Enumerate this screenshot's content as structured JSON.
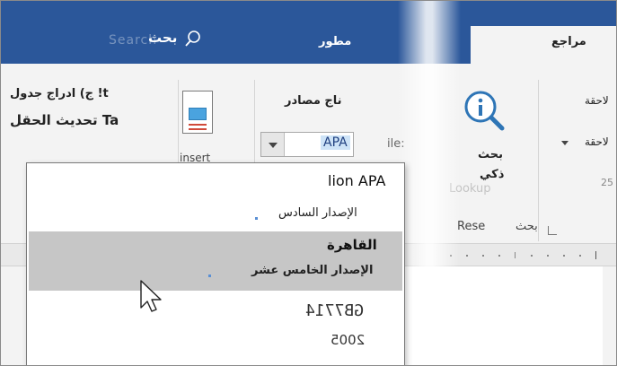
{
  "tabs": {
    "references": "مراجع",
    "developer": "مطور"
  },
  "search": {
    "label": "بحث",
    "ghost_text": "Search"
  },
  "ribbon": {
    "insert_table_line": "ج) ادراج جدول !t",
    "update_field_line": "تحديث الحقل Ta",
    "insert_caption_ghost": "insert",
    "manage_sources": "ناج مصادر",
    "style_label": "ile:",
    "style_value": "APA",
    "smart_lookup_1": "بحث",
    "smart_lookup_2": "ذكي",
    "lookup_ghost": "Lookup",
    "research_group": "Rese",
    "research_group_ar": "بحث",
    "citations_1": "لاحقة",
    "citations_2": "لاحقة",
    "group_number": "25"
  },
  "style_list": [
    {
      "title": "lion APA",
      "subtitle": "الإصدار السادس",
      "selected": false
    },
    {
      "title": "القاهرة",
      "subtitle": "الإصدار الخامس عشر",
      "selected": true
    },
    {
      "title": "GB7714",
      "subtitle": "2005",
      "selected": false
    }
  ],
  "colors": {
    "ribbon_accent": "#2b579a",
    "selection": "#c6c6c6",
    "highlight": "#cde3f7"
  }
}
